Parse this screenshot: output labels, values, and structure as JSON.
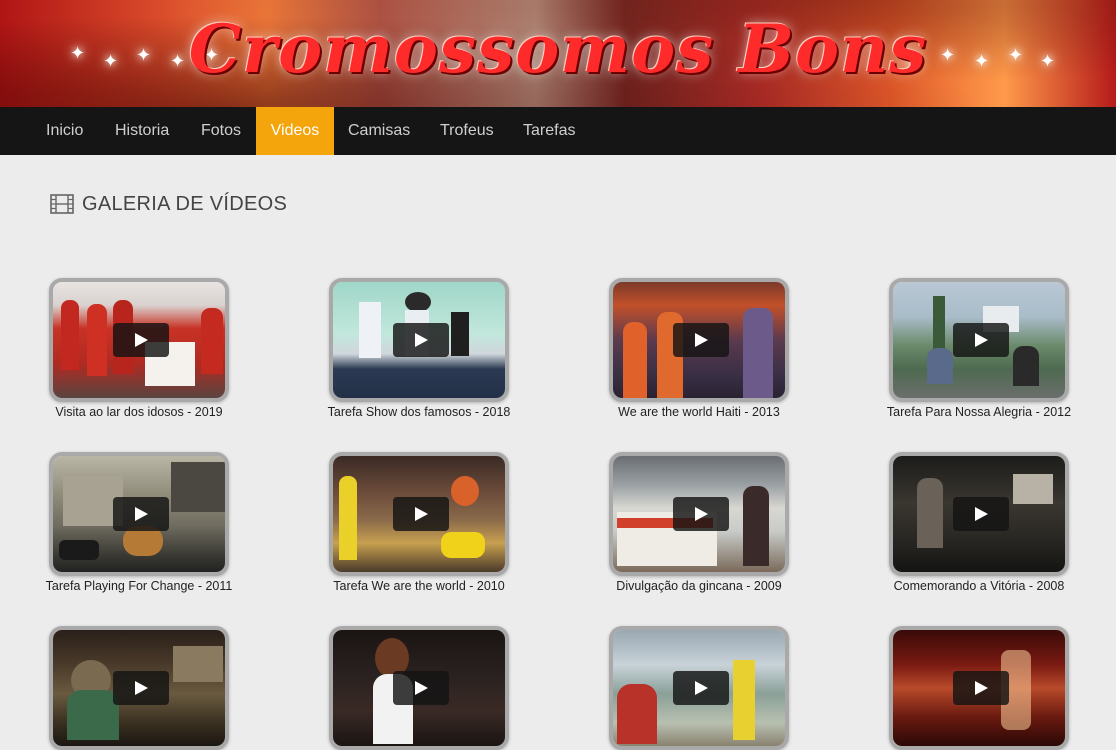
{
  "banner": {
    "title": "Cromossomos Bons"
  },
  "nav": {
    "items": [
      {
        "label": "Inicio",
        "active": false
      },
      {
        "label": "Historia",
        "active": false
      },
      {
        "label": "Fotos",
        "active": false
      },
      {
        "label": "Videos",
        "active": true
      },
      {
        "label": "Camisas",
        "active": false
      },
      {
        "label": "Trofeus",
        "active": false
      },
      {
        "label": "Tarefas",
        "active": false
      }
    ]
  },
  "gallery": {
    "title": "GALERIA DE VÍDEOS",
    "icon": "film-icon",
    "videos": [
      {
        "caption": "Visita ao lar dos idosos - 2019"
      },
      {
        "caption": "Tarefa Show dos famosos - 2018"
      },
      {
        "caption": "We are the world Haiti - 2013"
      },
      {
        "caption": "Tarefa Para Nossa Alegria - 2012"
      },
      {
        "caption": "Tarefa Playing For Change - 2011"
      },
      {
        "caption": "Tarefa We are the world - 2010"
      },
      {
        "caption": "Divulgação da gincana - 2009"
      },
      {
        "caption": "Comemorando a Vitória - 2008"
      },
      {
        "caption": ""
      },
      {
        "caption": ""
      },
      {
        "caption": ""
      },
      {
        "caption": ""
      }
    ]
  },
  "colors": {
    "nav_bg": "#151515",
    "nav_active": "#f5a50c",
    "page_bg": "#ececec",
    "banner_red": "#ff2a2a"
  }
}
